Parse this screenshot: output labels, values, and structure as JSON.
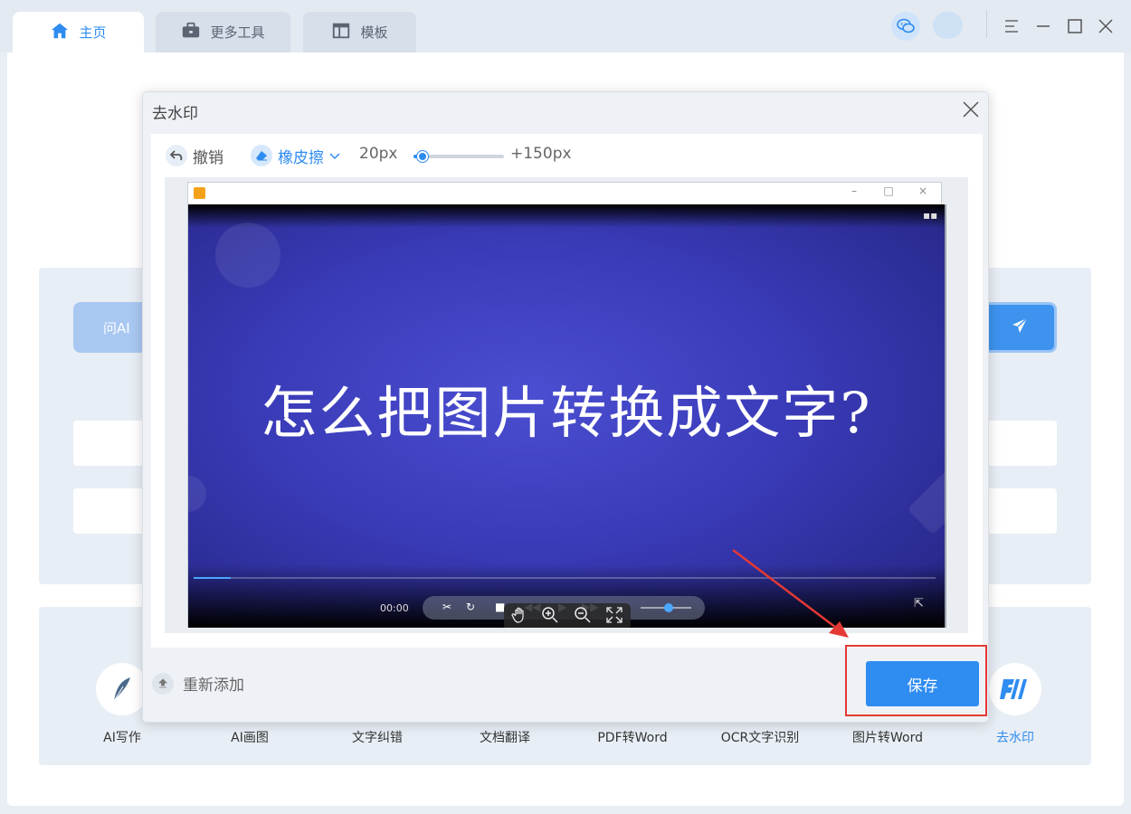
{
  "tabs": [
    {
      "label": "主页",
      "icon": "home-icon"
    },
    {
      "label": "更多工具",
      "icon": "briefcase-icon"
    },
    {
      "label": "模板",
      "icon": "template-icon"
    }
  ],
  "background_page": {
    "ask_button": "问AI",
    "tools": [
      {
        "label": "AI写作",
        "icon": "feather-pen-icon"
      },
      {
        "label": "AI画图",
        "icon": ""
      },
      {
        "label": "文字纠错",
        "icon": ""
      },
      {
        "label": "文档翻译",
        "icon": ""
      },
      {
        "label": "PDF转Word",
        "icon": ""
      },
      {
        "label": "OCR文字识别",
        "icon": ""
      },
      {
        "label": "图片转Word",
        "icon": ""
      },
      {
        "label": "去水印",
        "icon": "watermark-remove-icon"
      }
    ]
  },
  "modal": {
    "title": "去水印",
    "toolbar": {
      "undo": "撤销",
      "eraser": "橡皮擦",
      "brush_min": "20px",
      "brush_max": "+150px",
      "brush_level": 0.1
    },
    "preview": {
      "video_text": "怎么把图片转换成文字?",
      "time": "00:00",
      "progress": 0.05
    },
    "readd_label": "重新添加",
    "save_label": "保存"
  },
  "colors": {
    "accent": "#2f8cf0",
    "annotation": "#e53935"
  }
}
